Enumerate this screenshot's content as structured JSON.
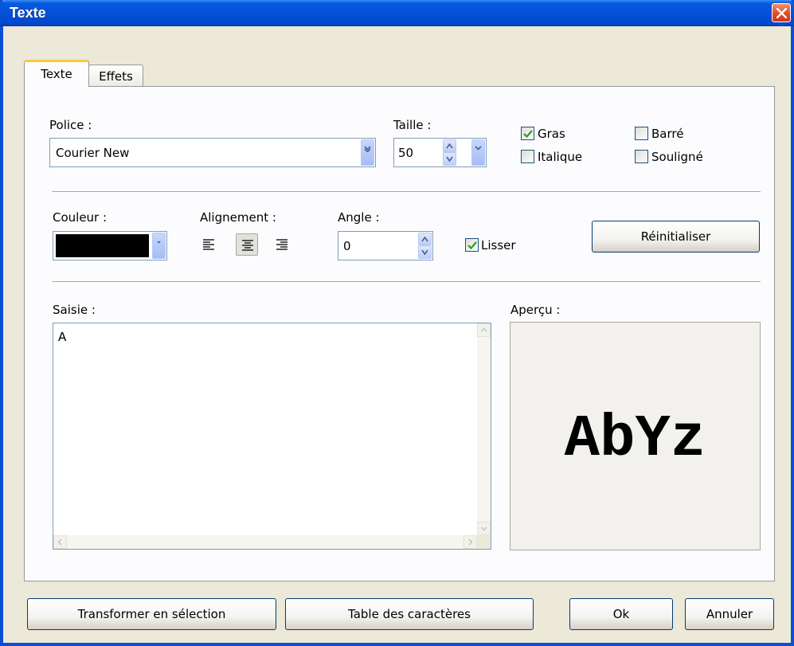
{
  "window": {
    "title": "Texte"
  },
  "tabs": [
    {
      "label": "Texte",
      "active": true
    },
    {
      "label": "Effets",
      "active": false
    }
  ],
  "font": {
    "police_label": "Police :",
    "police_value": "Courier New",
    "taille_label": "Taille :",
    "taille_value": "50"
  },
  "styles": {
    "gras": {
      "label": "Gras",
      "checked": true
    },
    "italique": {
      "label": "Italique",
      "checked": false
    },
    "barre": {
      "label": "Barré",
      "checked": false
    },
    "souligne": {
      "label": "Souligné",
      "checked": false
    }
  },
  "color": {
    "label": "Couleur :",
    "value": "#000000"
  },
  "alignment": {
    "label": "Alignement :",
    "selected": "center",
    "options": [
      "left-align-icon",
      "center-align-icon",
      "right-align-icon"
    ]
  },
  "angle": {
    "label": "Angle :",
    "value": "0"
  },
  "lisser": {
    "label": "Lisser",
    "checked": true
  },
  "reset_button": "Réinitialiser",
  "input": {
    "label": "Saisie :",
    "value": "A"
  },
  "preview": {
    "label": "Aperçu :",
    "text": "AbYz"
  },
  "buttons": {
    "transform": "Transformer en sélection",
    "charmap": "Table des caractères",
    "ok": "Ok",
    "cancel": "Annuler"
  },
  "colors": {
    "titlebar": "#0550d8",
    "dialog_bg": "#ece9d8",
    "tab_highlight": "#ffc73c",
    "check": "#21a121"
  }
}
